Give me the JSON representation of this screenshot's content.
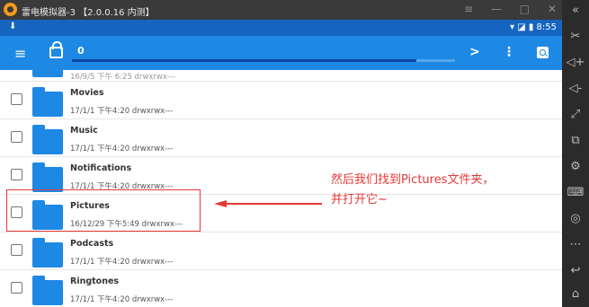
{
  "window": {
    "title": "雷电模拟器-3 【2.0.0.16 内测】",
    "controls": "≡ — □ ✕"
  },
  "statusbar": {
    "download_icon": "⬇",
    "time_text": "▾ ◪ ▮ 8:55"
  },
  "toolbar": {
    "menu_icon": "≡",
    "path_label": "0",
    "next_icon": ">",
    "more_icon": "⋮"
  },
  "files": {
    "partial_meta": "16/9/5 下午 6:25  drwxrwx---",
    "items": [
      {
        "name": "Movies",
        "meta": "17/1/1 下午4:20  drwxrwx---"
      },
      {
        "name": "Music",
        "meta": "17/1/1 下午4:20  drwxrwx---"
      },
      {
        "name": "Notifications",
        "meta": "17/1/1 下午4:20  drwxrwx---"
      },
      {
        "name": "Pictures",
        "meta": "16/12/29 下午5:49  drwxrwx---"
      },
      {
        "name": "Podcasts",
        "meta": "17/1/1 下午4:20  drwxrwx---"
      },
      {
        "name": "Ringtones",
        "meta": "17/1/1 下午4:20  drwxrwx---"
      }
    ]
  },
  "annotation": {
    "line1": "然后我们找到Pictures文件夹，",
    "line2": "并打开它~",
    "color": "#e53935"
  },
  "sidebar": {
    "icons": [
      "«",
      "✂",
      "◁+",
      "◁-",
      "⤢",
      "⧉",
      "⚙",
      "⌨",
      "◎",
      "⋯",
      "↩",
      "⌂"
    ]
  },
  "colors": {
    "statusbar": "#1565c0",
    "toolbar": "#1e88e5",
    "folder": "#1e88e5"
  }
}
